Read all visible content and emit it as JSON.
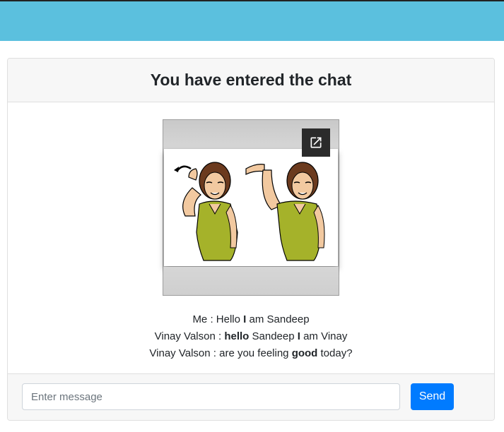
{
  "header": {
    "title": "You have entered the chat"
  },
  "video": {
    "popout_icon": "open-in-new-icon"
  },
  "messages": [
    {
      "sender": "Me",
      "sep": " : ",
      "parts": [
        {
          "text": "Hello ",
          "bold": false
        },
        {
          "text": "I",
          "bold": true
        },
        {
          "text": " am Sandeep",
          "bold": false
        }
      ]
    },
    {
      "sender": "Vinay Valson",
      "sep": " : ",
      "parts": [
        {
          "text": "hello",
          "bold": true
        },
        {
          "text": " Sandeep ",
          "bold": false
        },
        {
          "text": "I",
          "bold": true
        },
        {
          "text": " am Vinay",
          "bold": false
        }
      ]
    },
    {
      "sender": "Vinay Valson",
      "sep": " : ",
      "parts": [
        {
          "text": "are you feeling ",
          "bold": false
        },
        {
          "text": "good",
          "bold": true
        },
        {
          "text": " today?",
          "bold": false
        }
      ]
    }
  ],
  "composer": {
    "placeholder": "Enter message",
    "value": "",
    "send_label": "Send"
  },
  "colors": {
    "topbar": "#5bc0de",
    "send": "#007bff"
  }
}
